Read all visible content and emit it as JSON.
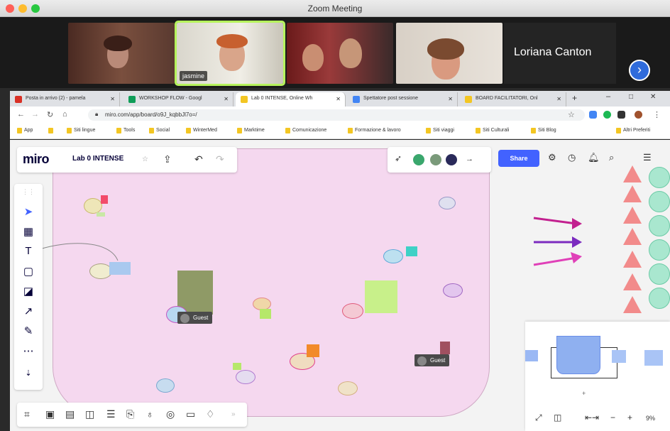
{
  "zoom": {
    "window_title": "Zoom Meeting",
    "participants": [
      {
        "name": ""
      },
      {
        "name": "jasmine"
      },
      {
        "name": ""
      },
      {
        "name": ""
      }
    ],
    "name_tile": "Loriana Canton"
  },
  "browser": {
    "tabs": [
      {
        "label": "Posta in arrivo (2) - pamela",
        "color": "#d93025"
      },
      {
        "label": "WORKSHOP FLOW - Googl",
        "color": "#0f9d58"
      },
      {
        "label": "Lab 0 INTENSE, Online Wh",
        "color": "#f3c623"
      },
      {
        "label": "Spettatore post sessione",
        "color": "#4285f4"
      },
      {
        "label": "BOARD FACILITATORI, Onl",
        "color": "#f3c623"
      }
    ],
    "url": "miro.com/app/board/o9J_kqbbJl7o=/",
    "bookmarks": [
      "App",
      "",
      "Siti lingue",
      "Tools",
      "Social",
      "WinterMed",
      "Marktime",
      "Comunicazione",
      "Formazione & lavoro",
      "Siti viaggi",
      "Siti Culturali",
      "Siti Blog",
      "Altri Preferiti"
    ]
  },
  "miro": {
    "logo": "miro",
    "board_name": "Lab 0 INTENSE",
    "share_label": "Share",
    "guest_label_1": "Guest",
    "guest_label_2": "Guest",
    "zoom_level": "9%",
    "minimap_ruler": "+"
  },
  "colors": {
    "frame_bg": "#f5d8ef",
    "share_button": "#4262ff",
    "zoom_blue": "#2f6bdb",
    "arrow_magenta": "#c2208f",
    "arrow_purple": "#7b2bbf"
  }
}
